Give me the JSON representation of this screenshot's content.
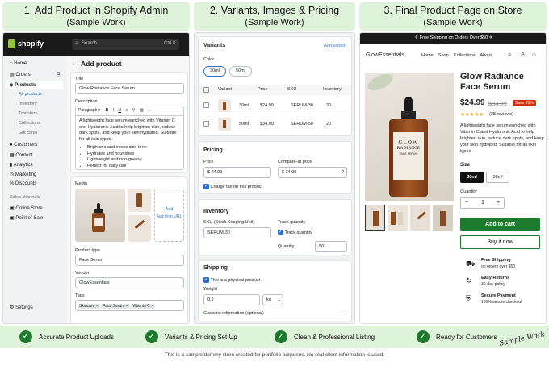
{
  "headers": [
    {
      "title": "1. Add Product in Shopify Admin",
      "sub": "(Sample Work)"
    },
    {
      "title": "2. Variants, Images & Pricing",
      "sub": "(Sample Work)"
    },
    {
      "title": "3. Final Product Page on Store",
      "sub": "(Sample Work)"
    }
  ],
  "admin": {
    "logo": "shopify",
    "search_placeholder": "Search",
    "shortcut": "Ctrl K",
    "nav": [
      {
        "label": "Home"
      },
      {
        "label": "Orders",
        "badge": "3"
      },
      {
        "label": "Products"
      }
    ],
    "subnav": [
      "All products",
      "Inventory",
      "Transfers",
      "Collections",
      "Gift cards"
    ],
    "nav2": [
      "Customers",
      "Content",
      "Analytics",
      "Marketing",
      "Discounts"
    ],
    "sales_channels": "Sales channels",
    "channels": [
      "Online Store",
      "Point of Sale"
    ],
    "settings": "Settings",
    "page_title": "Add product",
    "title_label": "Title",
    "title_value": "Glow Radiance Face Serum",
    "desc_label": "Description",
    "para": "Paragraph",
    "desc_text": "A lightweight face serum enriched with Vitamin C and Hyaluronic Acid to help brighten skin, reduce dark spots, and keep your skin hydrated. Suitable for all skin types.",
    "bullets": [
      "Brightens and evens skin tone",
      "Hydrates and nourishes",
      "Lightweight and non-greasy",
      "Perfect for daily use"
    ],
    "media_label": "Media",
    "add_label": "Add",
    "add_url": "Add from URL",
    "ptype_label": "Product type",
    "ptype_value": "Face Serum",
    "vendor_label": "Vendor",
    "vendor_value": "GlowEssentials",
    "tags_label": "Tags",
    "tags": [
      "Skincare",
      "Face Serum",
      "Vitamin C"
    ]
  },
  "variants": {
    "title": "Variants",
    "add": "Add variant",
    "color": "Color",
    "opts": [
      "30ml",
      "50ml"
    ],
    "cols": [
      "Variant",
      "Price",
      "SKU",
      "Inventory"
    ],
    "rows": [
      {
        "v": "30ml",
        "p": "$24.99",
        "s": "SERUM-30",
        "i": "30"
      },
      {
        "v": "50ml",
        "p": "$34.99",
        "s": "SERUM-50",
        "i": "20"
      }
    ],
    "pricing": "Pricing",
    "price_label": "Price",
    "price": "24.99",
    "cmp_label": "Compare-at price",
    "cmp": "34.99",
    "tax": "Charge tax on this product",
    "inventory": "Inventory",
    "sku_label": "SKU (Stock Keeping Unit)",
    "sku": "SERUM-30",
    "track_label": "Track quantity",
    "track": "Track quantity",
    "qty_label": "Quantity",
    "qty": "50",
    "shipping": "Shipping",
    "physical": "This is a physical product",
    "weight_label": "Weight",
    "weight": "0.2",
    "unit": "kg",
    "customs": "Customs information (optional)"
  },
  "store": {
    "banner": "✈ Free Shipping on Orders Over $50 ✈",
    "brand": "GlowEssentials",
    "menu": [
      "Home",
      "Shop",
      "Collections",
      "About"
    ],
    "name": "Glow Radiance Face Serum",
    "price": "$24.99",
    "old": "$34.99",
    "save": "Save 29%",
    "stars": "★★★★★",
    "reviews": "(28 reviews)",
    "desc": "A lightweight face serum enriched with Vitamin C and Hyaluronic Acid to help brighten skin, reduce dark spots, and keep your skin hydrated. Suitable for all skin types.",
    "size_label": "Size",
    "sizes": [
      "30ml",
      "50ml"
    ],
    "qty_label": "Quantity",
    "qty": "1",
    "cart": "Add to cart",
    "buy": "Buy it now",
    "features": [
      {
        "t": "Free Shipping",
        "s": "on orders over $50"
      },
      {
        "t": "Easy Returns",
        "s": "30-day policy"
      },
      {
        "t": "Secure Payment",
        "s": "100% secure checkout"
      }
    ],
    "label1": "GLOW",
    "label2": "RADIANCE",
    "label3": "FACE SERUM"
  },
  "bottom": [
    "Accurate Product Uploads",
    "Variants & Pricing Set Up",
    "Clean & Professional Listing",
    "Ready for Customers"
  ],
  "signature": "Sample Work",
  "footer": "This is a sample/dummy store created for portfolio purposes. No real client information is used.",
  "colors": {
    "accent": "#1e7a2e",
    "blue": "#2c6ecb",
    "header_bg": "#dff2da"
  }
}
